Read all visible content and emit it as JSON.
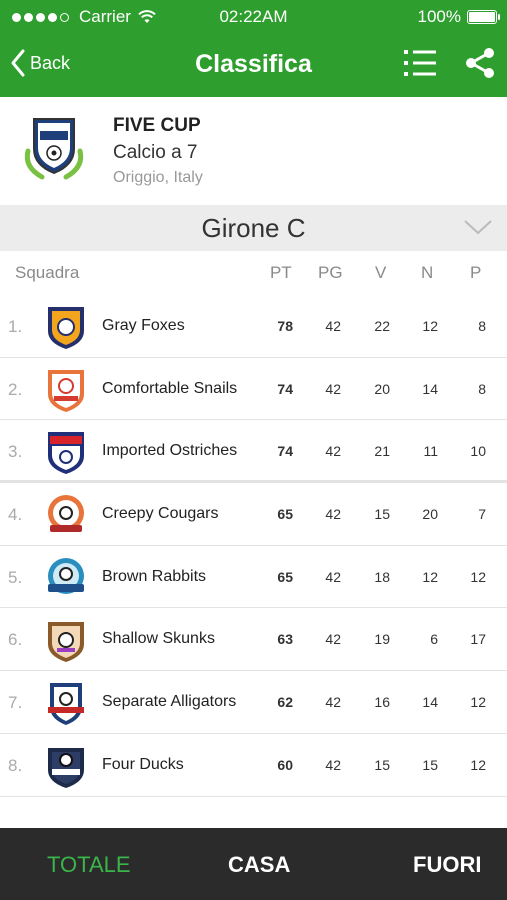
{
  "status": {
    "carrier": "Carrier",
    "time": "02:22AM",
    "battery": "100%",
    "battery_level": 1.0
  },
  "nav": {
    "back_label": "Back",
    "title": "Classifica"
  },
  "competition": {
    "name": "FIVE CUP",
    "type": "Calcio a 7",
    "location": "Origgio, Italy"
  },
  "group": {
    "title": "Girone C"
  },
  "columns": {
    "team": "Squadra",
    "pt": "PT",
    "pg": "PG",
    "v": "V",
    "n": "N",
    "p": "P"
  },
  "standings": [
    {
      "pos": "1.",
      "team": "Gray Foxes",
      "pt": "78",
      "pg": "42",
      "v": "22",
      "n": "12",
      "p": "8"
    },
    {
      "pos": "2.",
      "team": "Comfortable Snails",
      "pt": "74",
      "pg": "42",
      "v": "20",
      "n": "14",
      "p": "8"
    },
    {
      "pos": "3.",
      "team": "Imported Ostriches",
      "pt": "74",
      "pg": "42",
      "v": "21",
      "n": "11",
      "p": "10"
    },
    {
      "pos": "4.",
      "team": "Creepy Cougars",
      "pt": "65",
      "pg": "42",
      "v": "15",
      "n": "20",
      "p": "7"
    },
    {
      "pos": "5.",
      "team": "Brown Rabbits",
      "pt": "65",
      "pg": "42",
      "v": "18",
      "n": "12",
      "p": "12"
    },
    {
      "pos": "6.",
      "team": "Shallow Skunks",
      "pt": "63",
      "pg": "42",
      "v": "19",
      "n": "6",
      "p": "17"
    },
    {
      "pos": "7.",
      "team": "Separate Alligators",
      "pt": "62",
      "pg": "42",
      "v": "16",
      "n": "14",
      "p": "12"
    },
    {
      "pos": "8.",
      "team": "Four Ducks",
      "pt": "60",
      "pg": "42",
      "v": "15",
      "n": "15",
      "p": "12"
    }
  ],
  "tabs": {
    "total": "TOTALE",
    "home": "CASA",
    "away": "FUORI"
  },
  "colors": {
    "brand_green": "#2e9f2e",
    "active_tab": "#39b54a",
    "tabbar": "#2b2b2b"
  }
}
